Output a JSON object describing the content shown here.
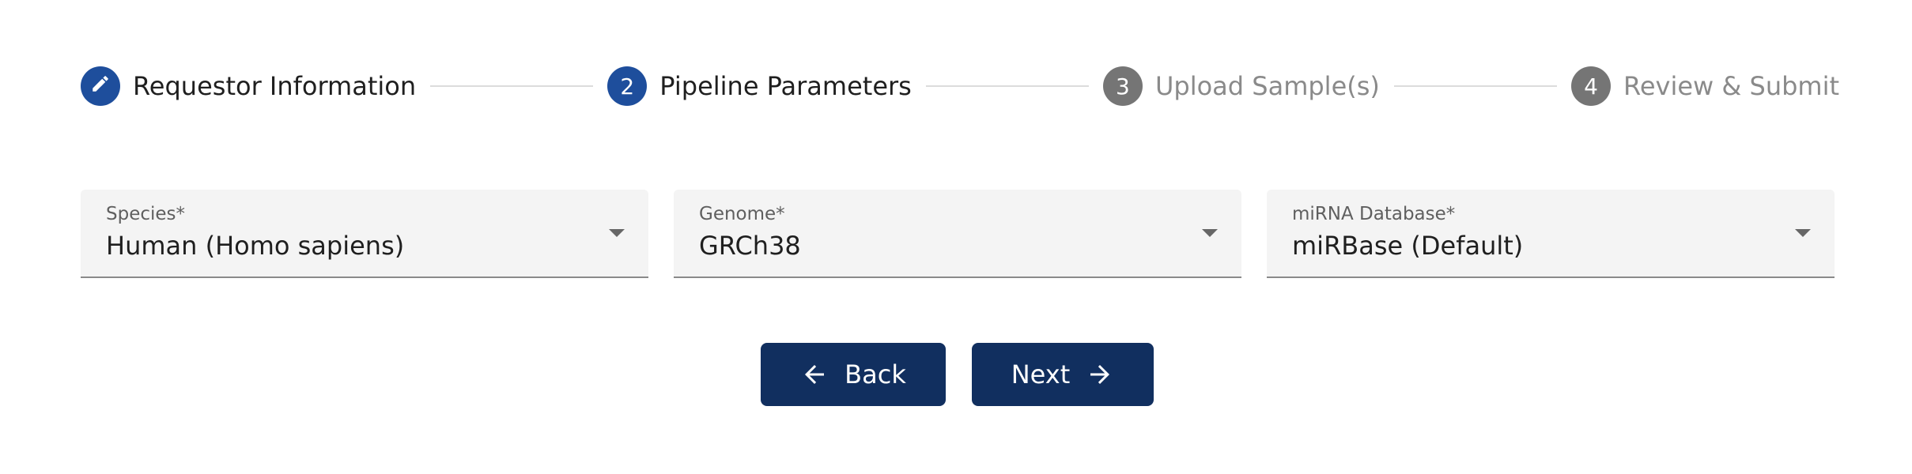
{
  "stepper": {
    "steps": [
      {
        "index": "",
        "label": "Requestor Information",
        "state": "completed",
        "icon": "pencil-icon"
      },
      {
        "index": "2",
        "label": "Pipeline Parameters",
        "state": "active"
      },
      {
        "index": "3",
        "label": "Upload Sample(s)",
        "state": "pending"
      },
      {
        "index": "4",
        "label": "Review & Submit",
        "state": "pending"
      }
    ]
  },
  "fields": {
    "species": {
      "label": "Species*",
      "value": "Human (Homo sapiens)"
    },
    "genome": {
      "label": "Genome*",
      "value": "GRCh38"
    },
    "mirna_db": {
      "label": "miRNA Database*",
      "value": "miRBase (Default)"
    }
  },
  "buttons": {
    "back_label": "Back",
    "next_label": "Next"
  },
  "colors": {
    "step_active": "#1e4e9c",
    "step_inactive": "#757575",
    "button_bg": "#112f5f",
    "field_bg": "#f4f4f4"
  }
}
